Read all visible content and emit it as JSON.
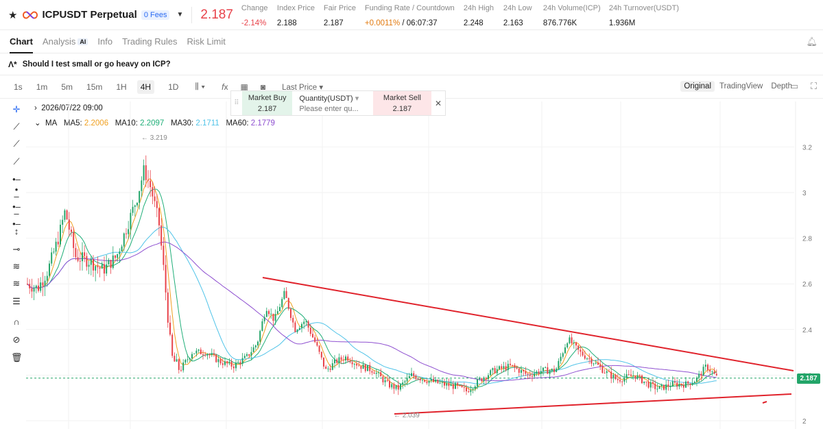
{
  "header": {
    "symbol": "ICPUSDT Perpetual",
    "fee_badge": "0 Fees",
    "price": "2.187",
    "stats": [
      {
        "label": "Change",
        "value": "-2.14%",
        "color": "#e8424a"
      },
      {
        "label": "Index Price",
        "value": "2.188"
      },
      {
        "label": "Fair Price",
        "value": "2.187"
      },
      {
        "label": "Funding Rate / Countdown",
        "value": "+0.0011%",
        "value2": " / 06:07:37",
        "color": "#e27a0f"
      },
      {
        "label": "24h High",
        "value": "2.248"
      },
      {
        "label": "24h Low",
        "value": "2.163"
      },
      {
        "label": "24h Volume(ICP)",
        "value": "876.776K"
      },
      {
        "label": "24h Turnover(USDT)",
        "value": "1.936M"
      }
    ]
  },
  "tabs": [
    "Chart",
    "Analysis",
    "Info",
    "Trading Rules",
    "Risk Limit"
  ],
  "analysis_badge": "AI",
  "question": "Should I test small or go heavy on ICP?",
  "timeframes": [
    "1s",
    "1m",
    "5m",
    "15m",
    "1H",
    "4H",
    "1D"
  ],
  "active_timeframe": "4H",
  "price_type": "Last Price",
  "views": [
    "Original",
    "TradingView",
    "Depth"
  ],
  "active_view": "Original",
  "chart_info": {
    "date": "2026/07/22 09:00",
    "ma_label": "MA",
    "ma": [
      {
        "name": "MA5:",
        "value": "2.2006",
        "color": "#f0a020"
      },
      {
        "name": "MA10:",
        "value": "2.2097",
        "color": "#1fae78"
      },
      {
        "name": "MA30:",
        "value": "2.1711",
        "color": "#4fc3e8"
      },
      {
        "name": "MA60:",
        "value": "2.1779",
        "color": "#8e4fd0"
      }
    ]
  },
  "trade_panel": {
    "buy_label": "Market Buy",
    "buy_price": "2.187",
    "qty_label": "Quantity(USDT)",
    "qty_placeholder": "Please enter qu...",
    "sell_label": "Market Sell",
    "sell_price": "2.187"
  },
  "price_axis": {
    "ticks": [
      "3.2",
      "3",
      "2.8",
      "2.6",
      "2.4",
      "2.2",
      "2"
    ],
    "current_tag": "2.187",
    "high_label": "3.219",
    "low_label": "2.039"
  },
  "colors": {
    "up": "#23a569",
    "down": "#e8424a",
    "trendline": "#e0222b",
    "accent": "#2a6af2"
  }
}
